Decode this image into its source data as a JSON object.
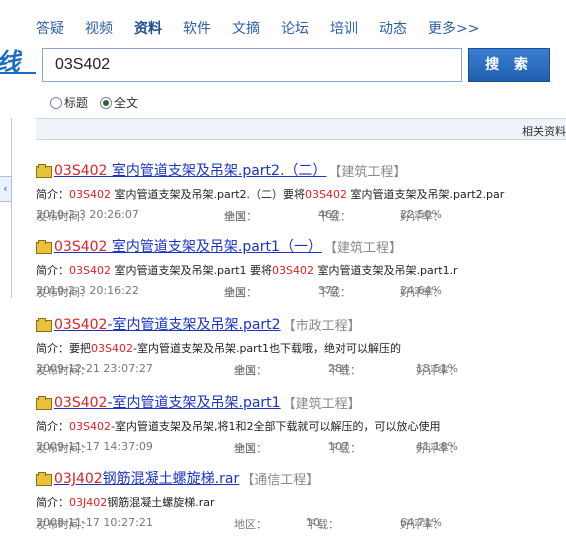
{
  "logo": {
    "fragment": "线"
  },
  "nav": {
    "items": [
      {
        "label": "答疑",
        "active": false
      },
      {
        "label": "视频",
        "active": false
      },
      {
        "label": "资料",
        "active": true
      },
      {
        "label": "软件",
        "active": false
      },
      {
        "label": "文摘",
        "active": false
      },
      {
        "label": "论坛",
        "active": false
      },
      {
        "label": "培训",
        "active": false
      },
      {
        "label": "动态",
        "active": false
      },
      {
        "label": "更多>>",
        "active": false
      }
    ]
  },
  "search": {
    "value": "03S402",
    "button_label": "搜 索",
    "options": [
      {
        "label": "标题",
        "checked": false
      },
      {
        "label": "全文",
        "checked": true
      }
    ]
  },
  "collapse_tab": {
    "glyph": "‹"
  },
  "related_bar": {
    "text": "相关资料"
  },
  "meta_labels": {
    "date": "发布时间：",
    "region": "地区：",
    "downloads": "下载：",
    "rating": "好评率："
  },
  "summary_label": "简介：",
  "results": [
    {
      "title_hl": "03S402",
      "title_rest": " 室内管道支架及吊架.part2.（二）",
      "category": "【建筑工程】",
      "summary_kw": "03S402",
      "summary_mid": " 室内管道支架及吊架.part2.（二）要将",
      "summary_kw2": "03S402",
      "summary_end": " 室内管道支架及吊架.part2.par",
      "date": "2010-2-3 20:26:07",
      "region": "全国",
      "downloads": "462",
      "rating": "22.50%"
    },
    {
      "title_hl": "03S402",
      "title_rest": " 室内管道支架及吊架.part1（一）",
      "category": "【建筑工程】",
      "summary_kw": "03S402",
      "summary_mid": " 室内管道支架及吊架.part1 要将",
      "summary_kw2": "03S402",
      "summary_end": " 室内管道支架及吊架.part1.r",
      "date": "2010-2-3 20:16:22",
      "region": "全国",
      "downloads": "372",
      "rating": "24.64%"
    },
    {
      "title_hl": "03S402",
      "title_rest": "-室内管道支架及吊架.part2",
      "category": "【市政工程】",
      "summary_pre": "要把",
      "summary_kw": "03S402",
      "summary_mid": "-室内管道支架及吊架.part1也下载哦，绝对可以解压的",
      "summary_kw2": "",
      "summary_end": "",
      "date": "2009-12-21 23:07:27",
      "region": "全国",
      "downloads": "284",
      "rating": "13.51%"
    },
    {
      "title_hl": "03S402",
      "title_rest": "-室内管道支架及吊架.part1",
      "category": "【建筑工程】",
      "summary_kw": "03S402",
      "summary_mid": "-室内管道支架及吊架,将1和2全部下载就可以解压的，可以放心使用",
      "summary_kw2": "",
      "summary_end": "",
      "date": "2009-11-17 14:37:09",
      "region": "全国",
      "downloads": "107",
      "rating": "41.18%"
    },
    {
      "title_hl": "03J402",
      "title_rest": "钢筋混凝土螺旋梯.rar",
      "category": "【通信工程】",
      "summary_kw": "03J402",
      "summary_mid": "钢筋混凝土螺旋梯.rar",
      "summary_kw2": "",
      "summary_end": "",
      "date": "2008-11-17 10:27:21",
      "region": "",
      "downloads": "10",
      "rating": "64.71%"
    }
  ]
}
